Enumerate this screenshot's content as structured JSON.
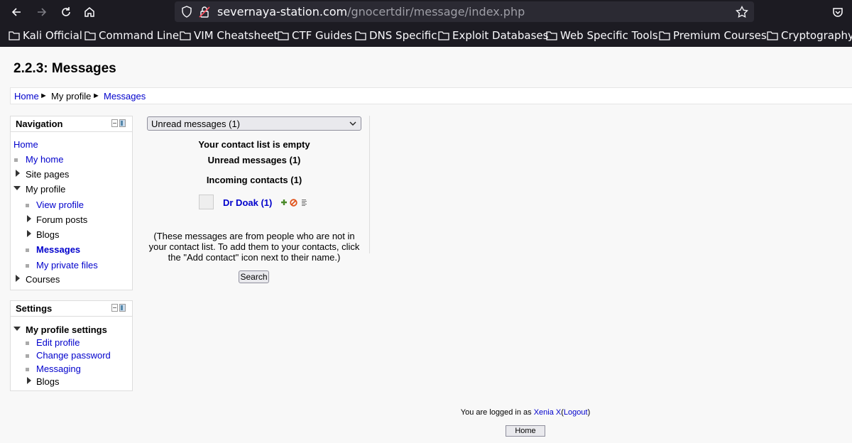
{
  "browser": {
    "url_host": "severnaya-station.com",
    "url_path": "/gnocertdir/message/index.php",
    "bookmarks": [
      "Kali Official",
      "Command Line",
      "VIM Cheatsheet",
      "CTF Guides",
      "DNS Specific",
      "Exploit Databases",
      "Web Specific Tools",
      "Premium Courses",
      "Cryptography"
    ]
  },
  "page": {
    "title": "2.2.3: Messages"
  },
  "breadcrumb": {
    "home": "Home",
    "sep1": "►",
    "profile": "My profile",
    "sep2": "►",
    "messages": "Messages"
  },
  "navigation": {
    "title": "Navigation",
    "home": "Home",
    "my_home": "My home",
    "site_pages": "Site pages",
    "my_profile": "My profile",
    "view_profile": "View profile",
    "forum_posts": "Forum posts",
    "blogs": "Blogs",
    "messages": "Messages",
    "my_private_files": "My private files",
    "courses": "Courses"
  },
  "settings": {
    "title": "Settings",
    "my_profile_settings": "My profile settings",
    "edit_profile": "Edit profile",
    "change_password": "Change password",
    "messaging": "Messaging",
    "blogs": "Blogs"
  },
  "main": {
    "view_select": "Unread messages (1)",
    "contact_list_empty": "Your contact list is empty",
    "unread_messages": "Unread messages (1)",
    "incoming_contacts": "Incoming contacts (1)",
    "contact_name": "Dr Doak (1)",
    "info_text": "(These messages are from people who are not in your contact list. To add them to your contacts, click the \"Add contact\" icon next to their name.)",
    "search_button": "Search"
  },
  "footer": {
    "logged_in_as": "You are logged in as",
    "user": "Xenia X",
    "paren_open": "(",
    "logout": "Logout",
    "paren_close": ")",
    "home_button": "Home"
  }
}
